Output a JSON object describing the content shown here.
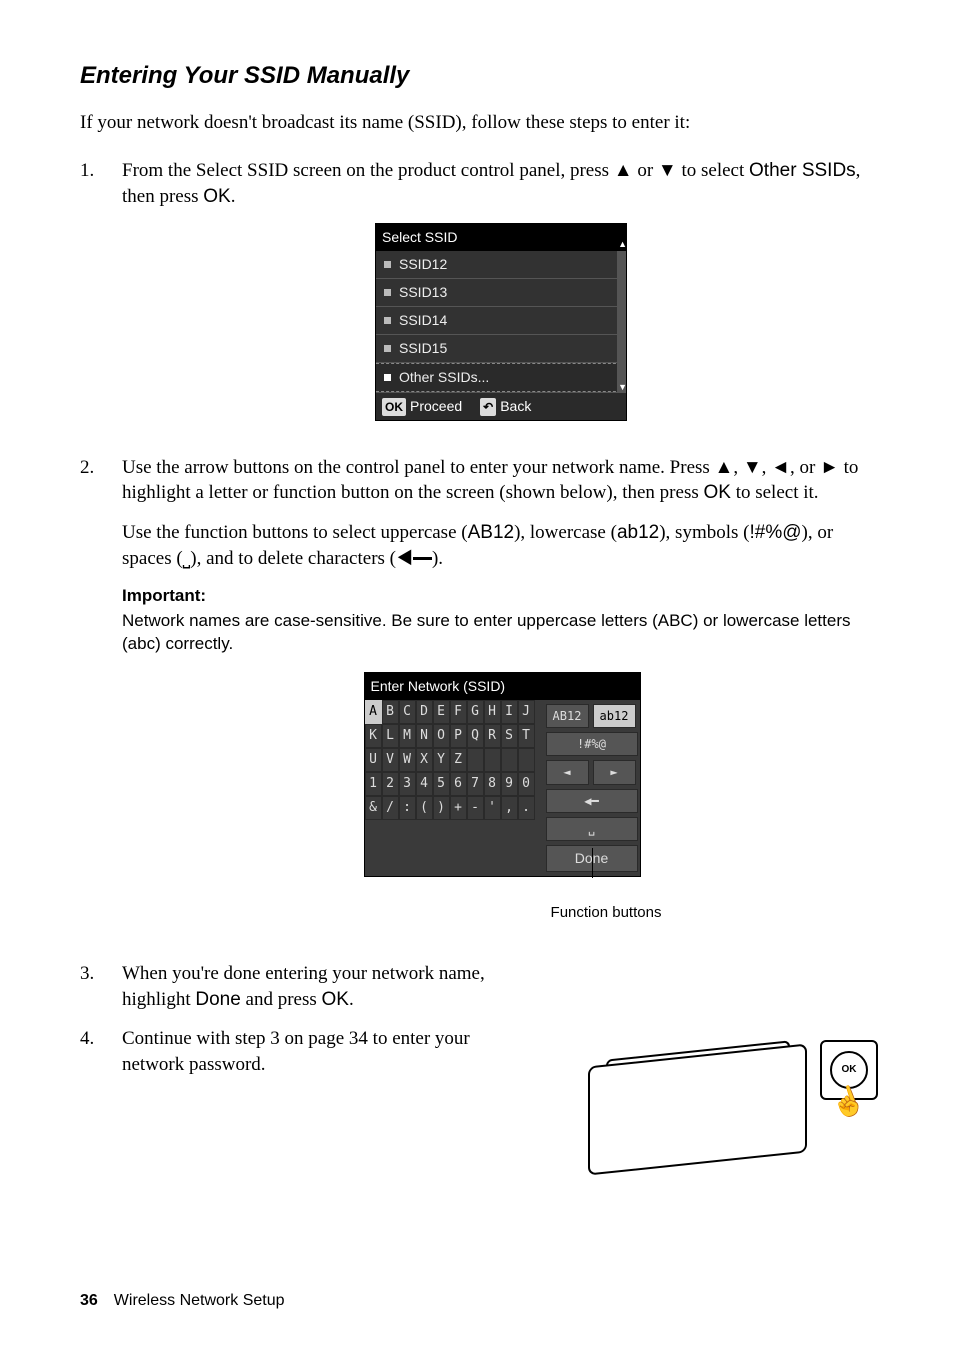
{
  "heading": "Entering Your SSID Manually",
  "intro": "If your network doesn't broadcast its name (SSID), follow these steps to enter it:",
  "step1": {
    "num": "1.",
    "pre": "From the Select SSID screen on the product control panel, press ",
    "mid": " or ",
    "post1": " to select ",
    "other": "Other SSIDs",
    "post2": ", then press ",
    "ok": "OK",
    "end": "."
  },
  "lcd1": {
    "title": "Select SSID",
    "items": [
      "SSID12",
      "SSID13",
      "SSID14",
      "SSID15",
      "Other SSIDs..."
    ],
    "okLabel": "OK",
    "proceed": "Proceed",
    "backIcon": "↶",
    "back": "Back"
  },
  "step2": {
    "num": "2.",
    "p1a": "Use the arrow buttons on the control panel to enter your network name. Press ",
    "p1b": ", ",
    "p1c": ", ",
    "p1d": ", or ",
    "p1e": " to highlight a letter or function button on the screen (shown below), then press ",
    "ok": "OK",
    "p1f": " to select it.",
    "p2a": "Use the function buttons to select uppercase (",
    "ab12u": "AB12",
    "p2b": "), lowercase (",
    "ab12l": "ab12",
    "p2c": "), symbols (",
    "sym": "!#%@",
    "p2d": "), or spaces (",
    "p2e": "), and to delete characters (",
    "p2f": ")."
  },
  "note": {
    "title": "Important:",
    "a": "Network names are case-sensitive. Be sure to enter uppercase letters (",
    "ABC": "ABC",
    "b": ") or lowercase letters (",
    "abc": "abc",
    "c": ") correctly."
  },
  "lcd2": {
    "title": "Enter Network (SSID)",
    "rows": [
      [
        "A",
        "B",
        "C",
        "D",
        "E",
        "F",
        "G",
        "H",
        "I",
        "J"
      ],
      [
        "K",
        "L",
        "M",
        "N",
        "O",
        "P",
        "Q",
        "R",
        "S",
        "T"
      ],
      [
        "U",
        "V",
        "W",
        "X",
        "Y",
        "Z",
        "",
        "",
        "",
        ""
      ],
      [
        "1",
        "2",
        "3",
        "4",
        "5",
        "6",
        "7",
        "8",
        "9",
        "0"
      ],
      [
        "&",
        "/",
        ":",
        "(",
        ")",
        "+",
        "-",
        "'",
        ",",
        "."
      ]
    ],
    "AB12": "AB12",
    "ab12": "ab12",
    "sym": "!#%@",
    "left": "◄",
    "right": "►",
    "bksp": "◀━",
    "space": "␣",
    "done": "Done"
  },
  "callout": "Function buttons",
  "step3": {
    "num": "3.",
    "a": "When you're done entering your network name, highlight ",
    "done": "Done",
    "b": " and press ",
    "ok": "OK",
    "c": "."
  },
  "step4": {
    "num": "4.",
    "text": "Continue with step 3 on page 34 to enter your network password."
  },
  "icons": {
    "up": "▲",
    "down": "▼",
    "left": "◄",
    "right": "►",
    "bksp": "◀━",
    "space": "⎵"
  },
  "printerOk": "OK",
  "footer": {
    "page": "36",
    "section": "Wireless Network Setup"
  }
}
